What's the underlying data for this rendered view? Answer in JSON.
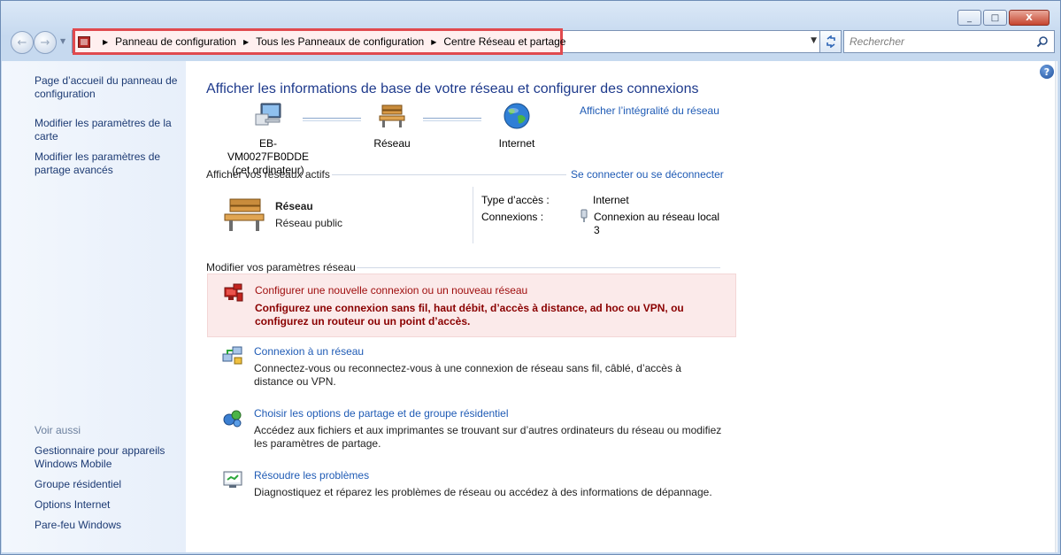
{
  "titlebar": {
    "minimize_label": "_",
    "maximize_label": "□",
    "close_label": "X"
  },
  "nav": {
    "back_icon": "←",
    "forward_icon": "→",
    "history_dropdown": "▼"
  },
  "address": {
    "icon": "control-panel-icon",
    "crumbs": [
      "Panneau de configuration",
      "Tous les Panneaux de configuration",
      "Centre Réseau et partage"
    ],
    "separator": "▶",
    "dropdown": "▼"
  },
  "search": {
    "placeholder": "Rechercher"
  },
  "sidebar": {
    "links": [
      "Page d’accueil du panneau de configuration",
      "Modifier les paramètres de la carte",
      "Modifier les paramètres de partage avancés"
    ],
    "see_also_heading": "Voir aussi",
    "see_also": [
      "Gestionnaire pour appareils Windows Mobile",
      "Groupe résidentiel",
      "Options Internet",
      "Pare-feu Windows"
    ]
  },
  "help": "?",
  "main": {
    "title": "Afficher les informations de base de votre réseau et configurer des connexions",
    "network_map_link": "Afficher l’intégralité du réseau",
    "nodes": [
      {
        "line1": "EB-VM0027FB0DDE",
        "line2": "(cet ordinateur)",
        "icon": "computer-icon"
      },
      {
        "line1": "Réseau",
        "icon": "bench-icon"
      },
      {
        "line1": "Internet",
        "icon": "globe-icon"
      }
    ],
    "active_networks_label": "Afficher vos réseaux actifs",
    "connect_link": "Se connecter ou se déconnecter",
    "active_network": {
      "name": "Réseau",
      "type_link": "Réseau public",
      "access_type_label": "Type d’accès :",
      "access_type_value": "Internet",
      "connections_label": "Connexions :",
      "connection_link_line1": "Connexion au réseau local",
      "connection_link_line2": "3"
    },
    "settings_label": "Modifier vos paramètres réseau",
    "tasks": [
      {
        "title": "Configurer une nouvelle connexion ou un nouveau réseau",
        "desc": "Configurez une connexion sans fil, haut débit, d’accès à distance, ad hoc ou VPN, ou configurez un routeur ou un point d’accès.",
        "icon": "new-connection-icon"
      },
      {
        "title": "Connexion à un réseau",
        "desc": "Connectez-vous ou reconnectez-vous à une connexion de réseau sans fil, câblé, d’accès à distance ou VPN.",
        "icon": "connect-network-icon"
      },
      {
        "title": "Choisir les options de partage et de groupe résidentiel",
        "desc": "Accédez aux fichiers et aux imprimantes se trouvant sur d’autres ordinateurs du réseau ou modifiez les paramètres de partage.",
        "icon": "homegroup-icon"
      },
      {
        "title": "Résoudre les problèmes",
        "desc": "Diagnostiquez et réparez les problèmes de réseau ou accédez à des informations de dépannage.",
        "icon": "troubleshoot-icon"
      }
    ]
  }
}
